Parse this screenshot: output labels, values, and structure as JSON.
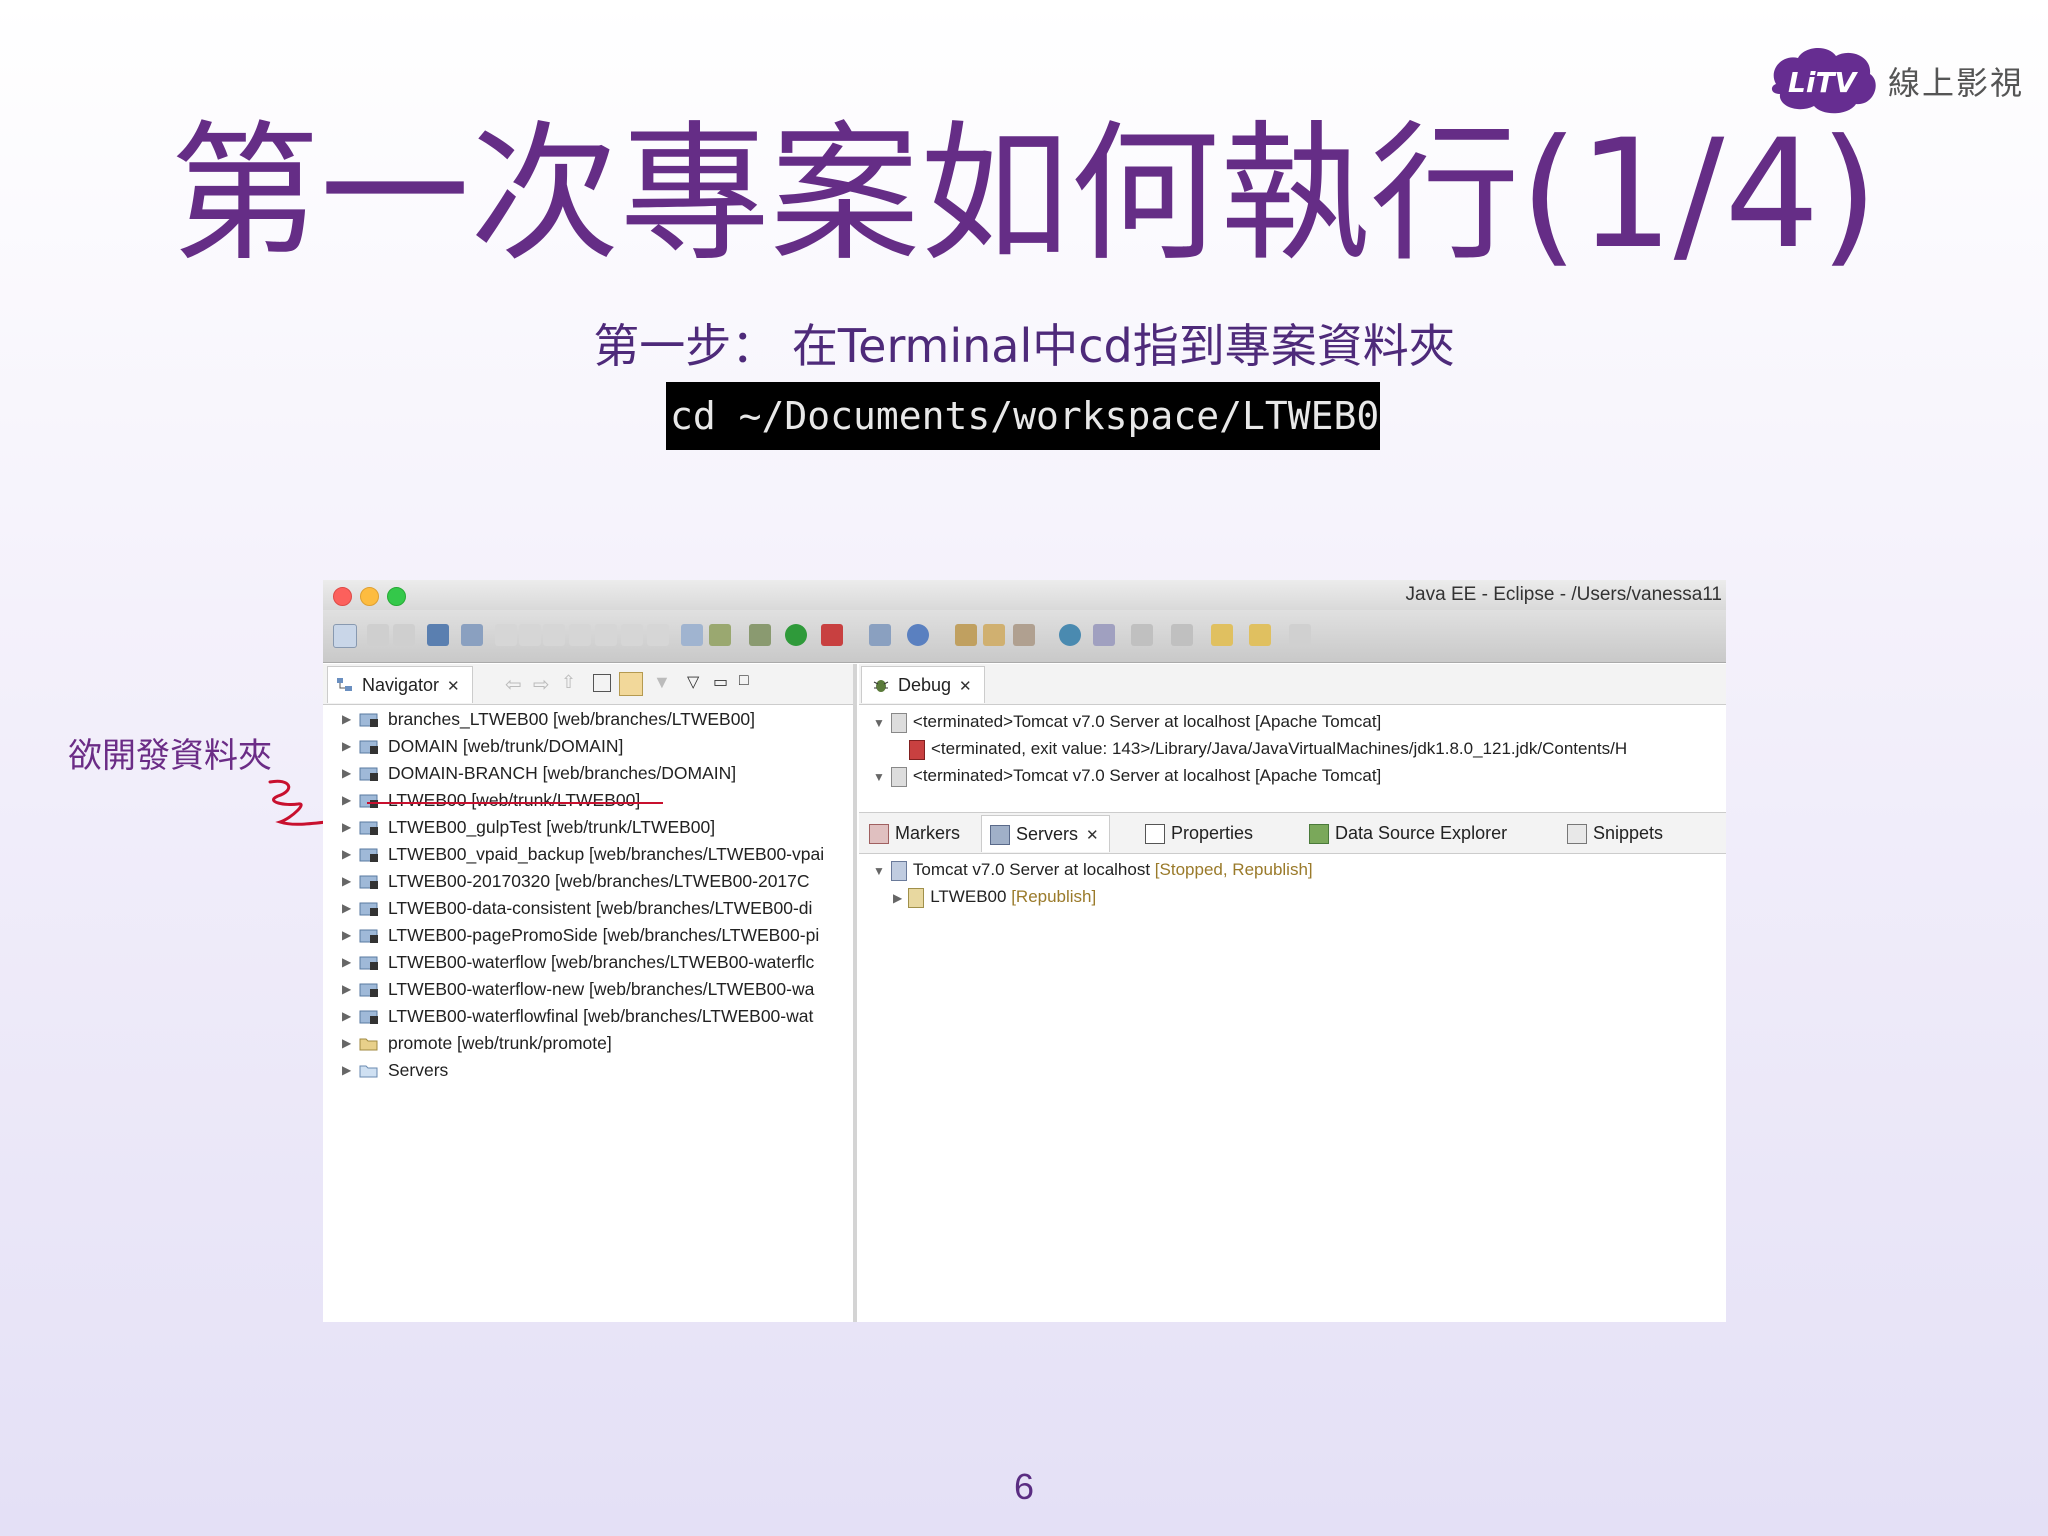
{
  "brand": {
    "logo_text": "LiTV",
    "name": "線上影視"
  },
  "slide": {
    "title": "第一次專案如何執行(1/4)",
    "subtitle": "第一步：  在Terminal中cd指到專案資料夾",
    "command": "cd ~/Documents/workspace/LTWEB00",
    "side_note": "欲開發資料夾",
    "page_number": "6"
  },
  "eclipse": {
    "window_title": "Java EE - Eclipse - /Users/vanessa11",
    "navigator": {
      "tab_label": "Navigator",
      "items": [
        {
          "label": "branches_LTWEB00 [web/branches/LTWEB00]",
          "icon": "project-icon"
        },
        {
          "label": "DOMAIN [web/trunk/DOMAIN]",
          "icon": "project-icon"
        },
        {
          "label": "DOMAIN-BRANCH [web/branches/DOMAIN]",
          "icon": "project-icon"
        },
        {
          "label": "LTWEB00 [web/trunk/LTWEB00]",
          "icon": "project-icon"
        },
        {
          "label": "LTWEB00_gulpTest [web/trunk/LTWEB00]",
          "icon": "project-icon"
        },
        {
          "label": "LTWEB00_vpaid_backup [web/branches/LTWEB00-vpai",
          "icon": "project-icon"
        },
        {
          "label": "LTWEB00-20170320 [web/branches/LTWEB00-2017C",
          "icon": "project-icon"
        },
        {
          "label": "LTWEB00-data-consistent [web/branches/LTWEB00-di",
          "icon": "project-icon"
        },
        {
          "label": "LTWEB00-pagePromoSide [web/branches/LTWEB00-pi",
          "icon": "project-icon"
        },
        {
          "label": "LTWEB00-waterflow [web/branches/LTWEB00-waterflc",
          "icon": "project-icon"
        },
        {
          "label": "LTWEB00-waterflow-new [web/branches/LTWEB00-wa",
          "icon": "project-icon"
        },
        {
          "label": "LTWEB00-waterflowfinal [web/branches/LTWEB00-wat",
          "icon": "project-icon"
        },
        {
          "label": "promote [web/trunk/promote]",
          "icon": "folder-icon"
        },
        {
          "label": "Servers",
          "icon": "folder-icon"
        }
      ]
    },
    "debug": {
      "tab_label": "Debug",
      "rows": [
        "<terminated>Tomcat v7.0 Server at localhost [Apache Tomcat]",
        "<terminated, exit value: 143>/Library/Java/JavaVirtualMachines/jdk1.8.0_121.jdk/Contents/H",
        "<terminated>Tomcat v7.0 Server at localhost [Apache Tomcat]"
      ]
    },
    "views_tabs": [
      "Markers",
      "Servers",
      "Properties",
      "Data Source Explorer",
      "Snippets"
    ],
    "servers": {
      "server_name": "Tomcat v7.0 Server at localhost",
      "server_status": "[Stopped, Republish]",
      "module_name": "LTWEB00",
      "module_status": "[Republish]"
    }
  },
  "colors": {
    "title": "#652d86",
    "accent_underline": "#c8102e",
    "terminal_bg": "#000000"
  }
}
